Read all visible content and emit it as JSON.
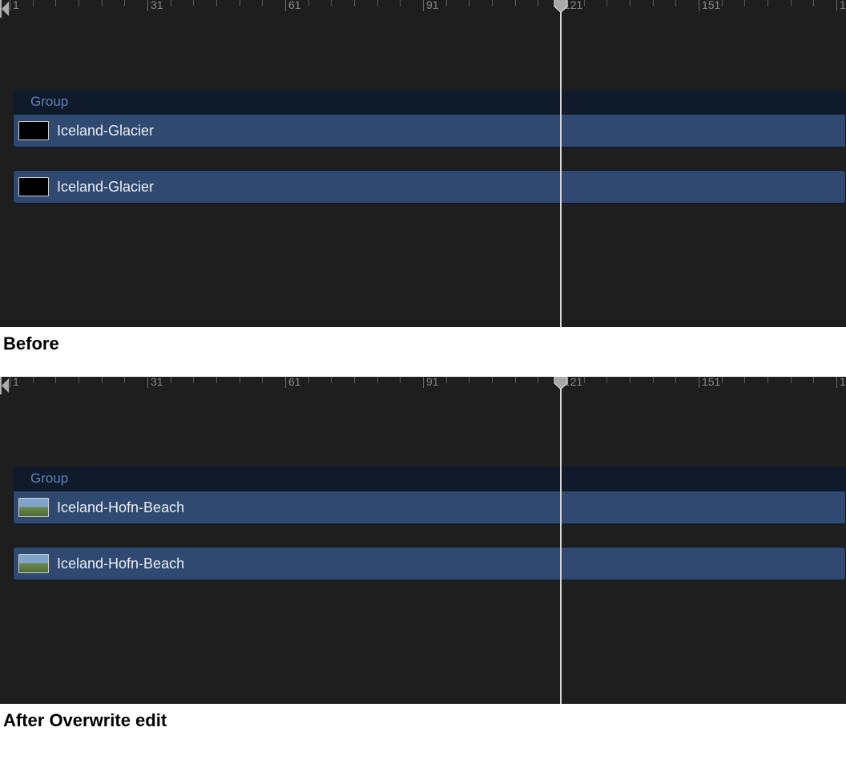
{
  "ruler": {
    "start": 1,
    "majorInterval": 30,
    "minorInterval": 5,
    "end": 186,
    "pxPerUnit": 5.733
  },
  "playhead": {
    "frame": 121
  },
  "captions": {
    "before": "Before",
    "after": "After Overwrite edit"
  },
  "panels": {
    "before": {
      "group": {
        "label": "Group"
      },
      "clips": [
        {
          "label": "Iceland-Glacier",
          "thumb": "black"
        },
        {
          "label": "Iceland-Glacier",
          "thumb": "black"
        }
      ]
    },
    "after": {
      "group": {
        "label": "Group"
      },
      "clips": [
        {
          "label": "Iceland-Hofn-Beach",
          "thumb": "landscape"
        },
        {
          "label": "Iceland-Hofn-Beach",
          "thumb": "landscape"
        }
      ]
    }
  }
}
